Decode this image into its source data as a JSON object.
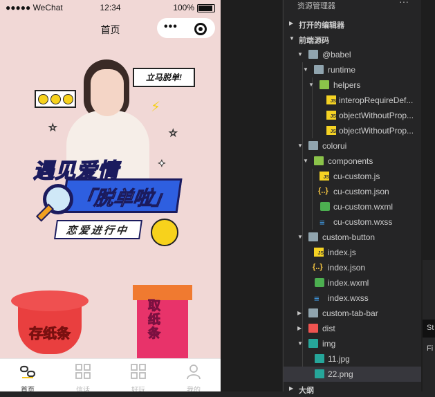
{
  "status_bar": {
    "carrier": "●●●●● WeChat",
    "time": "12:34",
    "battery": "100%"
  },
  "navbar": {
    "title": "首页",
    "capsule_dots": "•••"
  },
  "poster": {
    "bubble_text": "立马脱单!",
    "headline": "遇见爱情",
    "slogan": "「脱单啦」",
    "tag": "恋爱进行中",
    "gift_left_label": "存纸条",
    "gift_right_label": "取纸条"
  },
  "tabbar": [
    {
      "label": "首页",
      "icon": "link-icon",
      "active": true
    },
    {
      "label": "信话",
      "icon": "grid-icon",
      "active": false
    },
    {
      "label": "好玩",
      "icon": "grid-icon",
      "active": false
    },
    {
      "label": "我的",
      "icon": "user-icon",
      "active": false
    }
  ],
  "explorer": {
    "header": "资源管理器",
    "more": "···",
    "sections": {
      "open_editors": "打开的编辑器",
      "source": "前端源码",
      "outline": "大纲"
    },
    "tree": [
      {
        "label": "@babel",
        "type": "folder"
      },
      {
        "label": "runtime",
        "type": "folder"
      },
      {
        "label": "helpers",
        "type": "folder-open"
      },
      {
        "label": "interopRequireDef...",
        "type": "js"
      },
      {
        "label": "objectWithoutProp...",
        "type": "js"
      },
      {
        "label": "objectWithoutProp...",
        "type": "js"
      },
      {
        "label": "colorui",
        "type": "folder"
      },
      {
        "label": "components",
        "type": "folder-open"
      },
      {
        "label": "cu-custom.js",
        "type": "js"
      },
      {
        "label": "cu-custom.json",
        "type": "json"
      },
      {
        "label": "cu-custom.wxml",
        "type": "wxml"
      },
      {
        "label": "cu-custom.wxss",
        "type": "wxss"
      },
      {
        "label": "custom-button",
        "type": "folder"
      },
      {
        "label": "index.js",
        "type": "js"
      },
      {
        "label": "index.json",
        "type": "json"
      },
      {
        "label": "index.wxml",
        "type": "wxml"
      },
      {
        "label": "index.wxss",
        "type": "wxss"
      },
      {
        "label": "custom-tab-bar",
        "type": "folder"
      },
      {
        "label": "dist",
        "type": "folder"
      },
      {
        "label": "img",
        "type": "folder"
      },
      {
        "label": "11.jpg",
        "type": "image"
      },
      {
        "label": "22.png",
        "type": "image"
      }
    ],
    "icon_text": {
      "js": "JS",
      "json": "{..}",
      "wxss": "≡"
    },
    "twisties": {
      "open": "▼",
      "closed": "▶"
    }
  },
  "right_panel": {
    "label1": "St",
    "label2": "Fi"
  }
}
